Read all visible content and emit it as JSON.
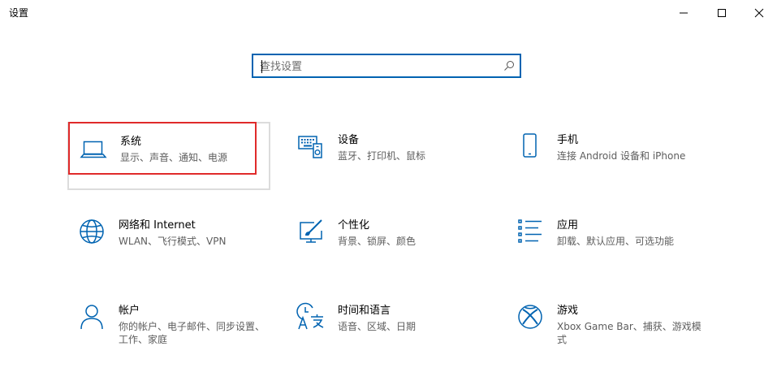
{
  "window": {
    "title": "设置",
    "minimize_label": "最小化",
    "maximize_label": "最大化",
    "close_label": "关闭"
  },
  "search": {
    "placeholder": "查找设置",
    "value": ""
  },
  "tiles": [
    {
      "title": "系统",
      "desc": "显示、声音、通知、电源",
      "icon": "laptop-icon"
    },
    {
      "title": "设备",
      "desc": "蓝牙、打印机、鼠标",
      "icon": "devices-icon"
    },
    {
      "title": "手机",
      "desc": "连接 Android 设备和 iPhone",
      "icon": "phone-icon"
    },
    {
      "title": "网络和 Internet",
      "desc": "WLAN、飞行模式、VPN",
      "icon": "globe-icon"
    },
    {
      "title": "个性化",
      "desc": "背景、锁屏、颜色",
      "icon": "personalization-icon"
    },
    {
      "title": "应用",
      "desc": "卸载、默认应用、可选功能",
      "icon": "apps-list-icon"
    },
    {
      "title": "帐户",
      "desc": "你的帐户、电子邮件、同步设置、工作、家庭",
      "icon": "person-icon"
    },
    {
      "title": "时间和语言",
      "desc": "语音、区域、日期",
      "icon": "time-language-icon"
    },
    {
      "title": "游戏",
      "desc": "Xbox Game Bar、捕获、游戏模式",
      "icon": "xbox-icon"
    }
  ],
  "colors": {
    "accent": "#0063b1",
    "highlight": "#e02a2a"
  }
}
